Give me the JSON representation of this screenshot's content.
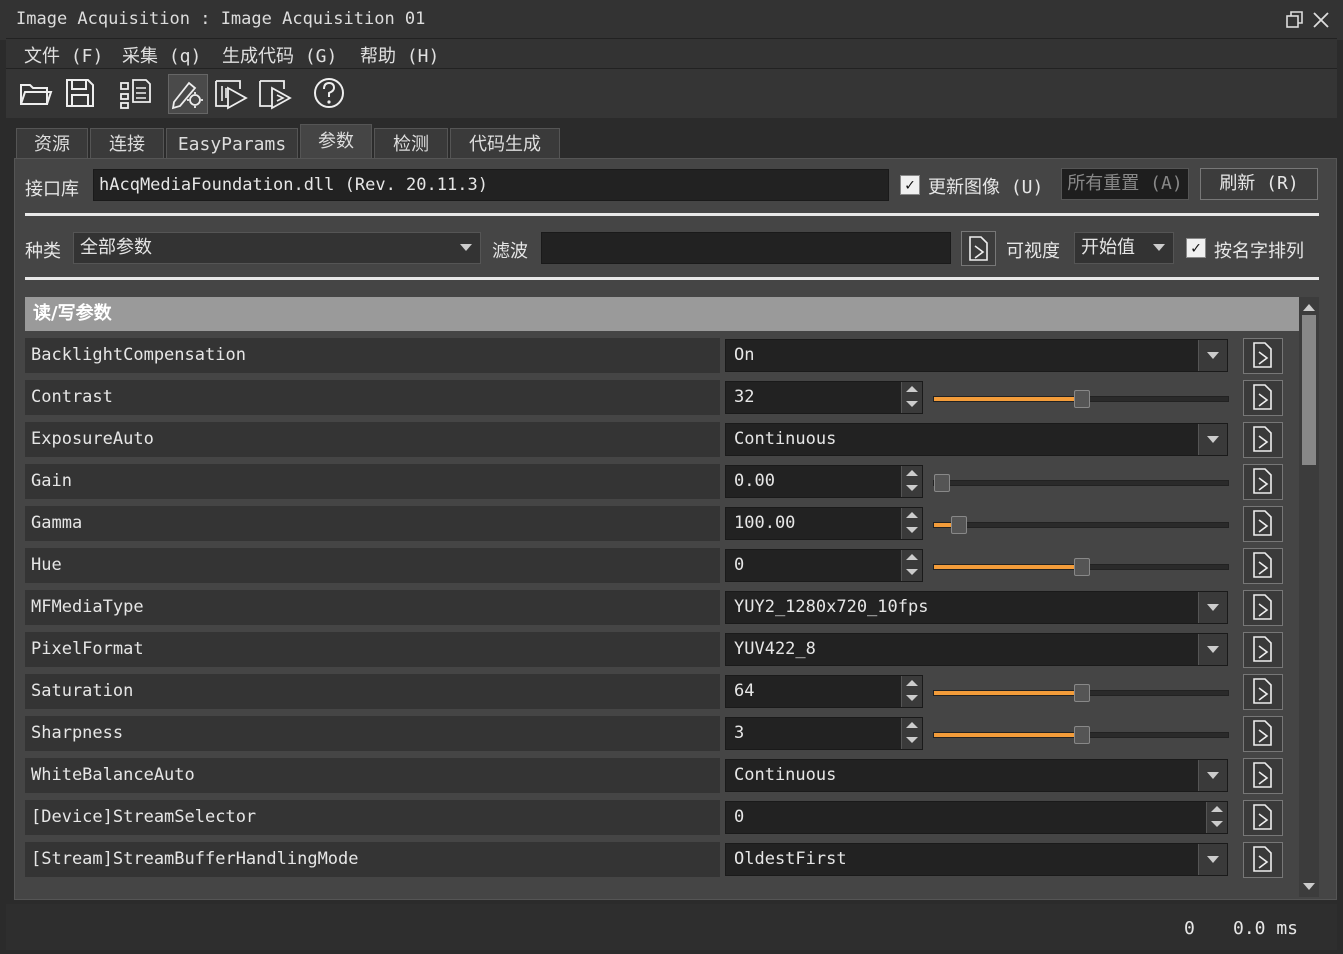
{
  "window": {
    "title": "Image Acquisition : Image Acquisition 01"
  },
  "menu": [
    "文件 (F)",
    "采集 (q)",
    "生成代码 (G)",
    "帮助 (H)"
  ],
  "toolbar": [
    "open-folder-icon",
    "save-icon",
    "device-list-icon",
    "settings-edit-icon",
    "live-play-icon",
    "snap-icon",
    "help-icon"
  ],
  "tabs": [
    "资源",
    "连接",
    "EasyParams",
    "参数",
    "检测",
    "代码生成"
  ],
  "active_tab": "参数",
  "interface": {
    "label": "接口库",
    "value": "hAcqMediaFoundation.dll (Rev. 20.11.3)",
    "update_image_label": "更新图像 (U)",
    "update_image_checked": true,
    "reset_all_label": "所有重置 (A)",
    "refresh_label": "刷新 (R)"
  },
  "filter": {
    "category_label": "种类",
    "category_value": "全部参数",
    "filter_label": "滤波",
    "filter_value": "",
    "visibility_label": "可视度",
    "visibility_value": "开始值",
    "sort_label": "按名字排列",
    "sort_checked": true
  },
  "section_title": "读/写参数",
  "params": [
    {
      "name": "BacklightCompensation",
      "type": "combo",
      "value": "On"
    },
    {
      "name": "Contrast",
      "type": "slider",
      "value": "32",
      "fraction": 0.5
    },
    {
      "name": "ExposureAuto",
      "type": "combo",
      "value": "Continuous"
    },
    {
      "name": "Gain",
      "type": "slider",
      "value": "0.00",
      "fraction": 0.0
    },
    {
      "name": "Gamma",
      "type": "slider",
      "value": "100.00",
      "fraction": 0.08
    },
    {
      "name": "Hue",
      "type": "slider",
      "value": "0",
      "fraction": 0.5
    },
    {
      "name": "MFMediaType",
      "type": "combo",
      "value": "YUY2_1280x720_10fps"
    },
    {
      "name": "PixelFormat",
      "type": "combo",
      "value": "YUV422_8"
    },
    {
      "name": "Saturation",
      "type": "slider",
      "value": "64",
      "fraction": 0.5
    },
    {
      "name": "Sharpness",
      "type": "slider",
      "value": "3",
      "fraction": 0.5
    },
    {
      "name": "WhiteBalanceAuto",
      "type": "combo",
      "value": "Continuous"
    },
    {
      "name": "[Device]StreamSelector",
      "type": "spin",
      "value": "0"
    },
    {
      "name": "[Stream]StreamBufferHandlingMode",
      "type": "combo",
      "value": "OldestFirst"
    }
  ],
  "status": {
    "count": "0",
    "time": "0.0 ms"
  }
}
